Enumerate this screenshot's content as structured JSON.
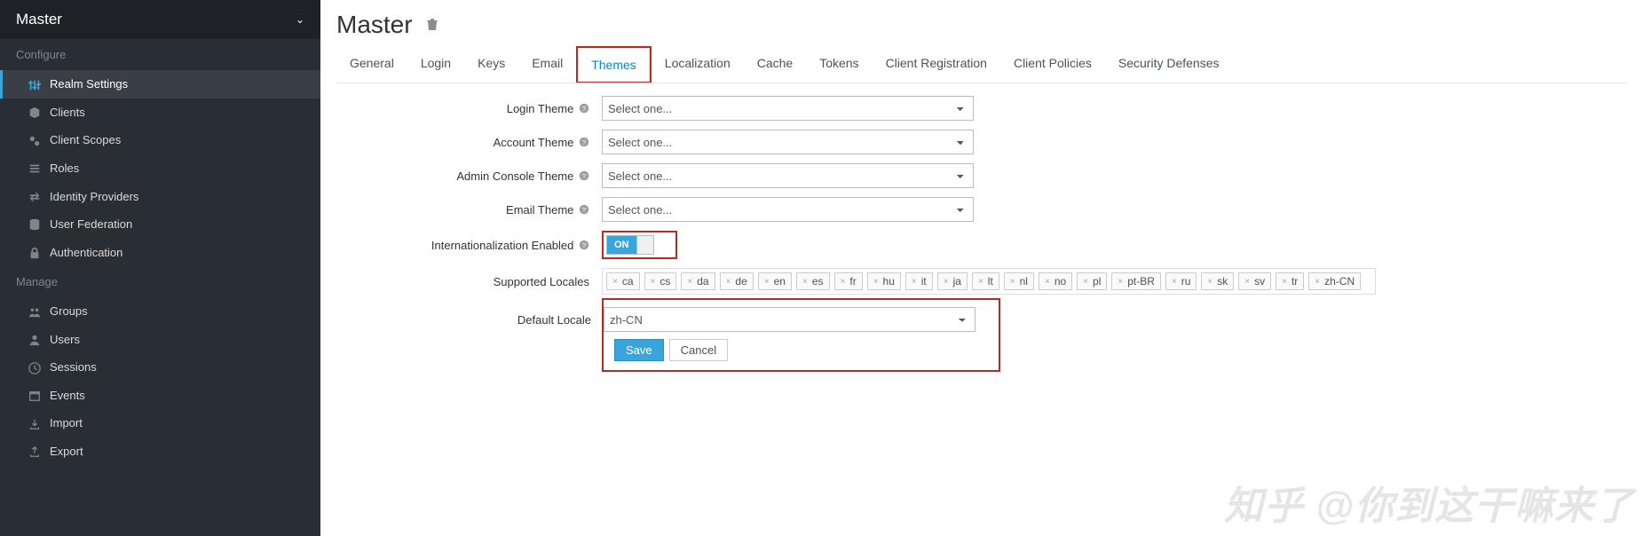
{
  "realm_selector": {
    "title": "Master"
  },
  "sections": {
    "configure": "Configure",
    "manage": "Manage"
  },
  "nav": {
    "realm_settings": "Realm Settings",
    "clients": "Clients",
    "client_scopes": "Client Scopes",
    "roles": "Roles",
    "identity_providers": "Identity Providers",
    "user_federation": "User Federation",
    "authentication": "Authentication",
    "groups": "Groups",
    "users": "Users",
    "sessions": "Sessions",
    "events": "Events",
    "import": "Import",
    "export": "Export"
  },
  "page": {
    "title": "Master"
  },
  "tabs": {
    "general": "General",
    "login": "Login",
    "keys": "Keys",
    "email": "Email",
    "themes": "Themes",
    "localization": "Localization",
    "cache": "Cache",
    "tokens": "Tokens",
    "client_reg": "Client Registration",
    "client_policies": "Client Policies",
    "security": "Security Defenses"
  },
  "form": {
    "login_theme": {
      "label": "Login Theme",
      "value": "Select one..."
    },
    "account_theme": {
      "label": "Account Theme",
      "value": "Select one..."
    },
    "admin_theme": {
      "label": "Admin Console Theme",
      "value": "Select one..."
    },
    "email_theme": {
      "label": "Email Theme",
      "value": "Select one..."
    },
    "intl": {
      "label": "Internationalization Enabled",
      "on": "ON"
    },
    "supported_locales": {
      "label": "Supported Locales"
    },
    "default_locale": {
      "label": "Default Locale",
      "value": "zh-CN"
    }
  },
  "locales": [
    "ca",
    "cs",
    "da",
    "de",
    "en",
    "es",
    "fr",
    "hu",
    "it",
    "ja",
    "lt",
    "nl",
    "no",
    "pl",
    "pt-BR",
    "ru",
    "sk",
    "sv",
    "tr",
    "zh-CN"
  ],
  "buttons": {
    "save": "Save",
    "cancel": "Cancel"
  },
  "watermark": "知乎 @你到这干嘛来了"
}
